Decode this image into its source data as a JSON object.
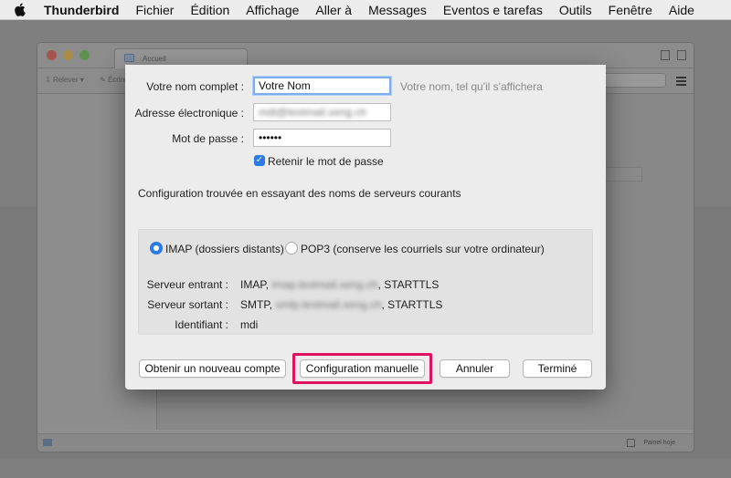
{
  "menubar": {
    "app_name": "Thunderbird",
    "items": [
      "Fichier",
      "Édition",
      "Affichage",
      "Aller à",
      "Messages",
      "Eventos e tarefas",
      "Outils",
      "Fenêtre",
      "Aide"
    ]
  },
  "background_window": {
    "tab_title": "Accueil",
    "toolbar_left": "Relever",
    "toolbar_write": "Écrire",
    "status_today": "Painel hoje"
  },
  "dialog": {
    "fullname_label": "Votre nom complet :",
    "fullname_value": "Votre Nom",
    "fullname_hint": "Votre nom, tel qu'il s'affichera",
    "email_label": "Adresse électronique :",
    "email_value": "mdi@testmail.xeng.ch",
    "password_label": "Mot de passe :",
    "password_value": "••••••",
    "remember_label": "Retenir le mot de passe",
    "config_found": "Configuration trouvée en essayant des noms de serveurs courants",
    "imap_label": "IMAP (dossiers distants)",
    "pop3_label": "POP3 (conserve les courriels sur votre ordinateur)",
    "incoming_label": "Serveur entrant :",
    "incoming_proto": "IMAP,",
    "incoming_host": "imap.testmail.xeng.ch",
    "incoming_sec": ", STARTTLS",
    "outgoing_label": "Serveur sortant :",
    "outgoing_proto": "SMTP,",
    "outgoing_host": "smtp.testmail.xeng.ch",
    "outgoing_sec": ", STARTTLS",
    "identifier_label": "Identifiant :",
    "identifier_value": "mdi",
    "btn_new_account": "Obtenir un nouveau compte",
    "btn_manual": "Configuration manuelle",
    "btn_cancel": "Annuler",
    "btn_done": "Terminé"
  },
  "colors": {
    "accent": "#2d79e6",
    "highlight": "#e0115f"
  }
}
